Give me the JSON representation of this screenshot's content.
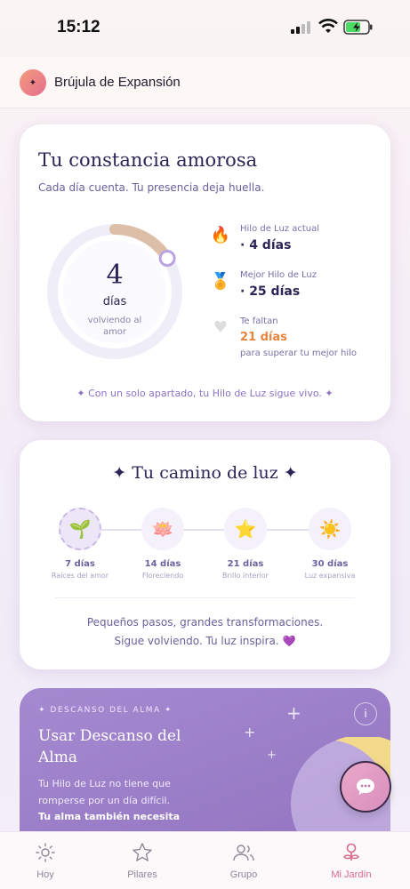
{
  "status_bar": {
    "time": "15:12"
  },
  "header": {
    "app_title": "Brújula de Expansión",
    "avatar_glyph": "✦"
  },
  "constancy_card": {
    "title": "Tu constancia amorosa",
    "subtitle": "Cada día cuenta. Tu presencia deja huella.",
    "ring": {
      "number": "4",
      "unit": "días",
      "caption": "volviendo al amor",
      "progress": 0.16
    },
    "stats": [
      {
        "icon": "fire-icon",
        "label": "Hilo de Luz actual",
        "value": "· 4 días"
      },
      {
        "icon": "medal-icon",
        "label": "Mejor Hilo de Luz",
        "value": "· 25 días"
      },
      {
        "icon": "heart-icon",
        "label": "Te faltan",
        "value": "21 días",
        "note": "para superar tu mejor hilo"
      }
    ],
    "footer": "✦ Con un solo apartado, tu Hilo de Luz sigue vivo. ✦"
  },
  "path_card": {
    "title": "✦ Tu camino de luz ✦",
    "steps": [
      {
        "days": "7 días",
        "name": "Raíces del amor",
        "emoji": "🌱"
      },
      {
        "days": "14 días",
        "name": "Floreciendo",
        "emoji": "🪷"
      },
      {
        "days": "21 días",
        "name": "Brillo interior",
        "emoji": "⭐"
      },
      {
        "days": "30 días",
        "name": "Luz expansiva",
        "emoji": "☀️"
      }
    ],
    "message_line1": "Pequeños pasos, grandes transformaciones.",
    "message_line2": "Sigue volviendo. Tu luz inspira. 💜"
  },
  "rest_card": {
    "kicker": "✦ DESCANSO DEL ALMA ✦",
    "title": "Usar Descanso del Alma",
    "text": "Tu Hilo de Luz no tiene que romperse por un día difícil.",
    "bold_text": "Tu alma también necesita"
  },
  "tab_bar": {
    "tabs": [
      {
        "label": "Hoy",
        "icon": "sun-icon"
      },
      {
        "label": "Pilares",
        "icon": "star-icon"
      },
      {
        "label": "Grupo",
        "icon": "group-icon"
      },
      {
        "label": "Mi Jardín",
        "icon": "garden-icon"
      }
    ],
    "active_color": "#d86a88"
  }
}
